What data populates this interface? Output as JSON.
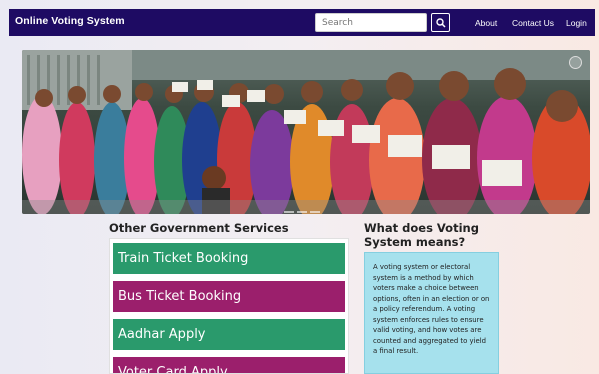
{
  "navbar": {
    "brand": "Online Voting System",
    "search_placeholder": "Search",
    "links": [
      "About",
      "Contact Us",
      "Login"
    ]
  },
  "icons": {
    "search": "search-icon",
    "expand": "expand-icon"
  },
  "services": {
    "title": "Other Government Services",
    "items": [
      {
        "label": "Train Ticket Booking",
        "color": "#2a9a6c"
      },
      {
        "label": "Bus Ticket Booking",
        "color": "#9b1f6c"
      },
      {
        "label": "Aadhar Apply",
        "color": "#2a9a6c"
      },
      {
        "label": "Voter Card Apply",
        "color": "#9b1f6c"
      }
    ]
  },
  "about": {
    "title": "What does Voting System means?",
    "text": "A voting system or electoral system is a method by which voters make a choice between options, often in an election or on a policy referendum. A voting system enforces rules to ensure valid voting, and how votes are counted and aggregated to yield a final result."
  },
  "colors": {
    "navbar": "#1e0b63",
    "card": "#a6e1ed"
  }
}
